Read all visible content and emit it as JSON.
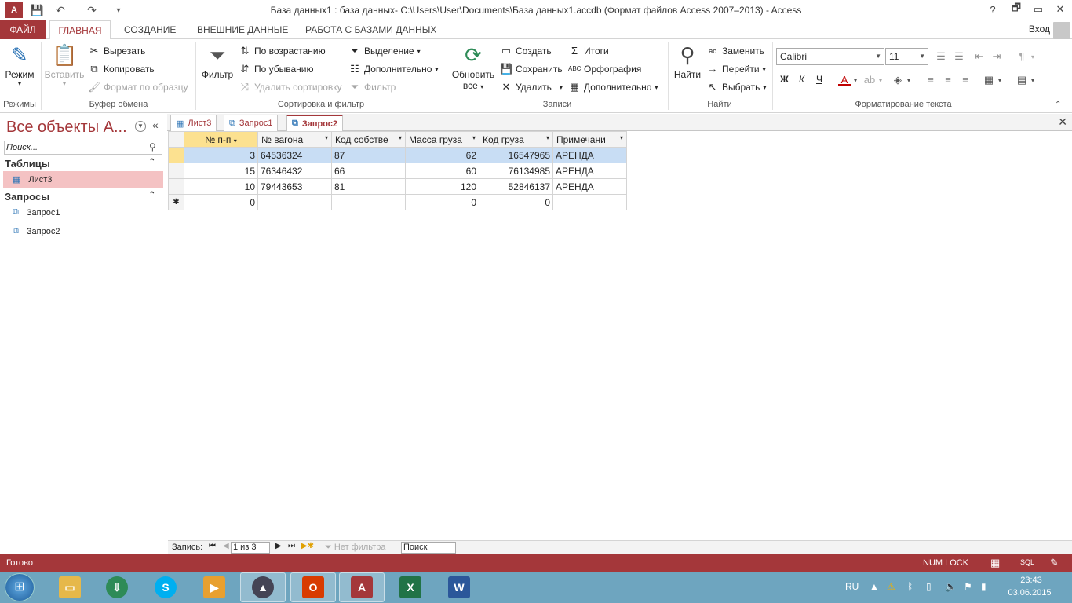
{
  "title_bar": {
    "app_icon": "A",
    "window_title": "База данных1 : база данных- C:\\Users\\User\\Documents\\База данных1.accdb (Формат файлов Access 2007–2013) - Access",
    "help": "?",
    "minimize": "🗗",
    "restore": "▭",
    "close": "✕"
  },
  "tabs": {
    "file": "ФАЙЛ",
    "home": "ГЛАВНАЯ",
    "create": "СОЗДАНИЕ",
    "external": "ВНЕШНИЕ ДАННЫЕ",
    "dbtools": "РАБОТА С БАЗАМИ ДАННЫХ",
    "signin": "Вход"
  },
  "ribbon": {
    "views": {
      "mode": "Режим",
      "group": "Режимы"
    },
    "clipboard": {
      "paste": "Вставить",
      "cut": "Вырезать",
      "copy": "Копировать",
      "format_painter": "Формат по образцу",
      "group": "Буфер обмена"
    },
    "sort_filter": {
      "filter": "Фильтр",
      "ascending": "По возрастанию",
      "descending": "По убыванию",
      "remove_sort": "Удалить сортировку",
      "selection": "Выделение",
      "advanced": "Дополнительно",
      "toggle_filter": "Фильтр",
      "group": "Сортировка и фильтр"
    },
    "records": {
      "refresh": "Обновить",
      "refresh_all": "все",
      "new": "Создать",
      "save": "Сохранить",
      "delete": "Удалить",
      "totals": "Итоги",
      "spelling": "Орфография",
      "more": "Дополнительно",
      "group": "Записи"
    },
    "find": {
      "find": "Найти",
      "replace": "Заменить",
      "goto": "Перейти",
      "select": "Выбрать",
      "group": "Найти"
    },
    "text_format": {
      "font": "Calibri",
      "size": "11",
      "bold": "Ж",
      "italic": "К",
      "underline": "Ч",
      "group": "Форматирование текста"
    }
  },
  "nav_pane": {
    "title": "Все объекты А...",
    "search_placeholder": "Поиск...",
    "tables_header": "Таблицы",
    "tables": [
      {
        "label": "Лист3"
      }
    ],
    "queries_header": "Запросы",
    "queries": [
      {
        "label": "Запрос1"
      },
      {
        "label": "Запрос2"
      }
    ]
  },
  "doc_tabs": [
    {
      "label": "Лист3"
    },
    {
      "label": "Запрос1"
    },
    {
      "label": "Запрос2"
    }
  ],
  "grid": {
    "columns": [
      "№ п-п",
      "№ вагона",
      "Код собстве",
      "Масса груза",
      "Код груза",
      "Примечани"
    ],
    "rows": [
      [
        "3",
        "64536324",
        "87",
        "62",
        "16547965",
        "АРЕНДА"
      ],
      [
        "15",
        "76346432",
        "66",
        "60",
        "76134985",
        "АРЕНДА"
      ],
      [
        "10",
        "79443653",
        "81",
        "120",
        "52846137",
        "АРЕНДА"
      ]
    ],
    "new_row": [
      "0",
      "",
      "",
      "0",
      "0",
      ""
    ],
    "new_row_marker": "✱"
  },
  "record_nav": {
    "label": "Запись:",
    "position": "1 из 3",
    "no_filter": "Нет фильтра",
    "search": "Поиск"
  },
  "status_bar": {
    "status": "Готово",
    "num_lock": "NUM LOCK",
    "sql": "SQL"
  },
  "taskbar": {
    "lang": "RU",
    "time": "23:43",
    "date": "03.06.2015"
  }
}
